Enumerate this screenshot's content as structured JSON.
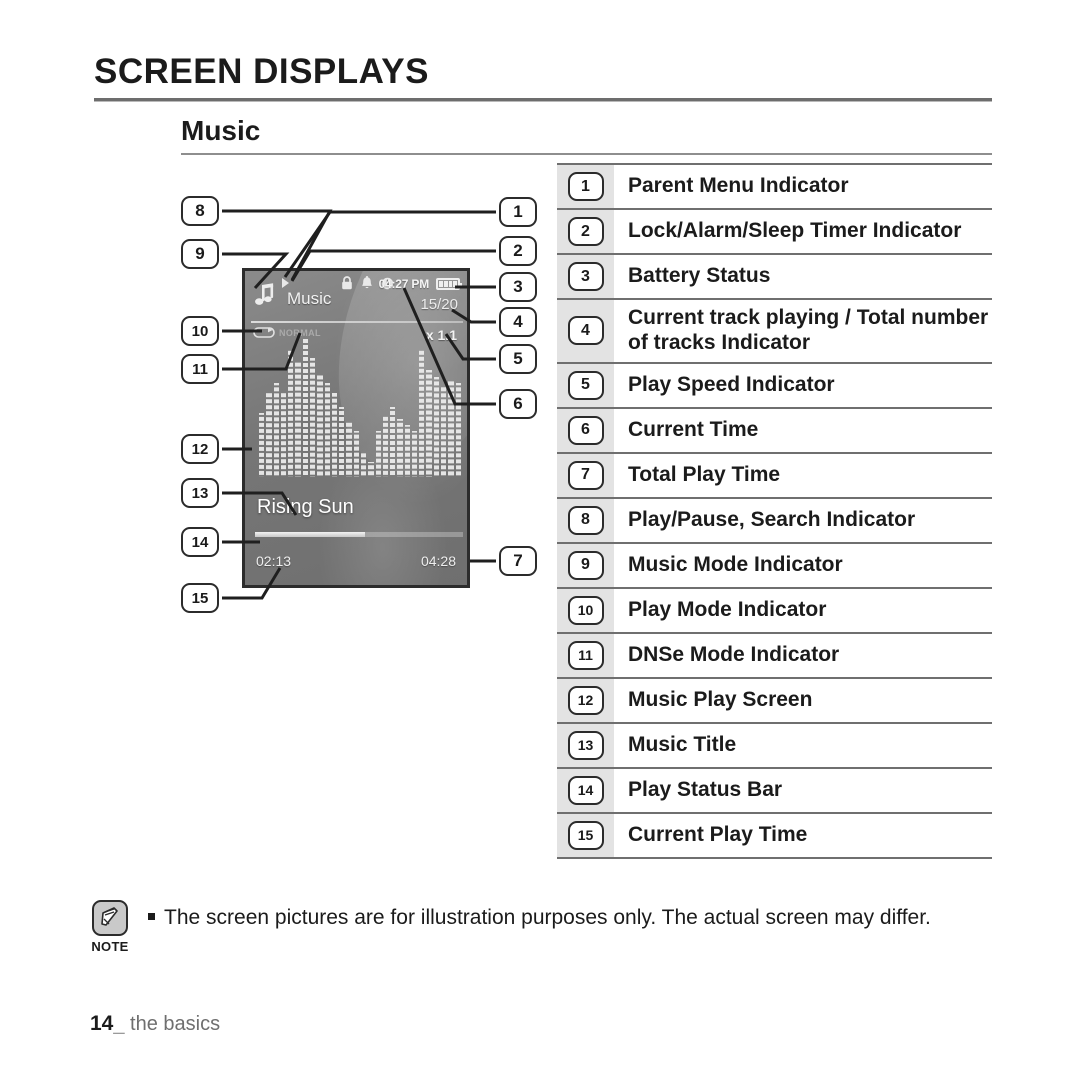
{
  "header": {
    "title": "SCREEN DISPLAYS",
    "section": "Music"
  },
  "device_screen": {
    "mode_label": "Music",
    "music_mode_icon": "music-note-icon",
    "play_state_icon": "play-triangle-icon",
    "status_icons": [
      "lock-icon",
      "alarm-bell-icon",
      "sleep-timer-clock-icon"
    ],
    "current_time": "04:27 PM",
    "battery_icon": "battery-full-icon",
    "battery_bars": 4,
    "track_count": "15/20",
    "play_speed": "x 1.1",
    "play_mode_icon": "repeat-loop-icon",
    "play_mode_label": "NORMAL",
    "music_title": "Rising Sun",
    "current_play_time": "02:13",
    "total_play_time": "04:28",
    "progress_percent": 53,
    "spectrum_levels": [
      42,
      56,
      62,
      56,
      84,
      76,
      92,
      78,
      68,
      62,
      55,
      46,
      36,
      30,
      16,
      10,
      30,
      40,
      46,
      38,
      34,
      30,
      84,
      70,
      66,
      60,
      64,
      62
    ]
  },
  "callouts_right": [
    {
      "num": "1"
    },
    {
      "num": "2"
    },
    {
      "num": "3"
    },
    {
      "num": "4"
    },
    {
      "num": "5"
    },
    {
      "num": "6"
    },
    {
      "num": "7"
    }
  ],
  "callouts_left": [
    {
      "num": "8"
    },
    {
      "num": "9"
    },
    {
      "num": "10"
    },
    {
      "num": "11"
    },
    {
      "num": "12"
    },
    {
      "num": "13"
    },
    {
      "num": "14"
    },
    {
      "num": "15"
    }
  ],
  "legend": [
    {
      "num": "1",
      "label": "Parent Menu Indicator"
    },
    {
      "num": "2",
      "label": "Lock/Alarm/Sleep Timer Indicator"
    },
    {
      "num": "3",
      "label": "Battery Status"
    },
    {
      "num": "4",
      "label": "Current track playing / Total number of tracks Indicator"
    },
    {
      "num": "5",
      "label": "Play Speed Indicator"
    },
    {
      "num": "6",
      "label": "Current Time"
    },
    {
      "num": "7",
      "label": "Total Play Time"
    },
    {
      "num": "8",
      "label": "Play/Pause, Search Indicator"
    },
    {
      "num": "9",
      "label": "Music Mode Indicator"
    },
    {
      "num": "10",
      "label": "Play Mode Indicator"
    },
    {
      "num": "11",
      "label": "DNSe Mode Indicator"
    },
    {
      "num": "12",
      "label": "Music Play Screen"
    },
    {
      "num": "13",
      "label": "Music Title"
    },
    {
      "num": "14",
      "label": "Play Status Bar"
    },
    {
      "num": "15",
      "label": "Current Play Time"
    }
  ],
  "note": {
    "icon": "note-pencil-icon",
    "icon_label": "NOTE",
    "text": "The screen pictures are for illustration purposes only. The actual screen may differ."
  },
  "footer": {
    "page_number": "14",
    "separator": "_",
    "section_name": "the basics"
  },
  "colors": {
    "text": "#1b1b1b",
    "rule": "#6f6f6f",
    "legend_num_bg": "#e3e3e3",
    "screen_bezel": "#2c2c2c",
    "footer_text": "#6f6f6f"
  }
}
